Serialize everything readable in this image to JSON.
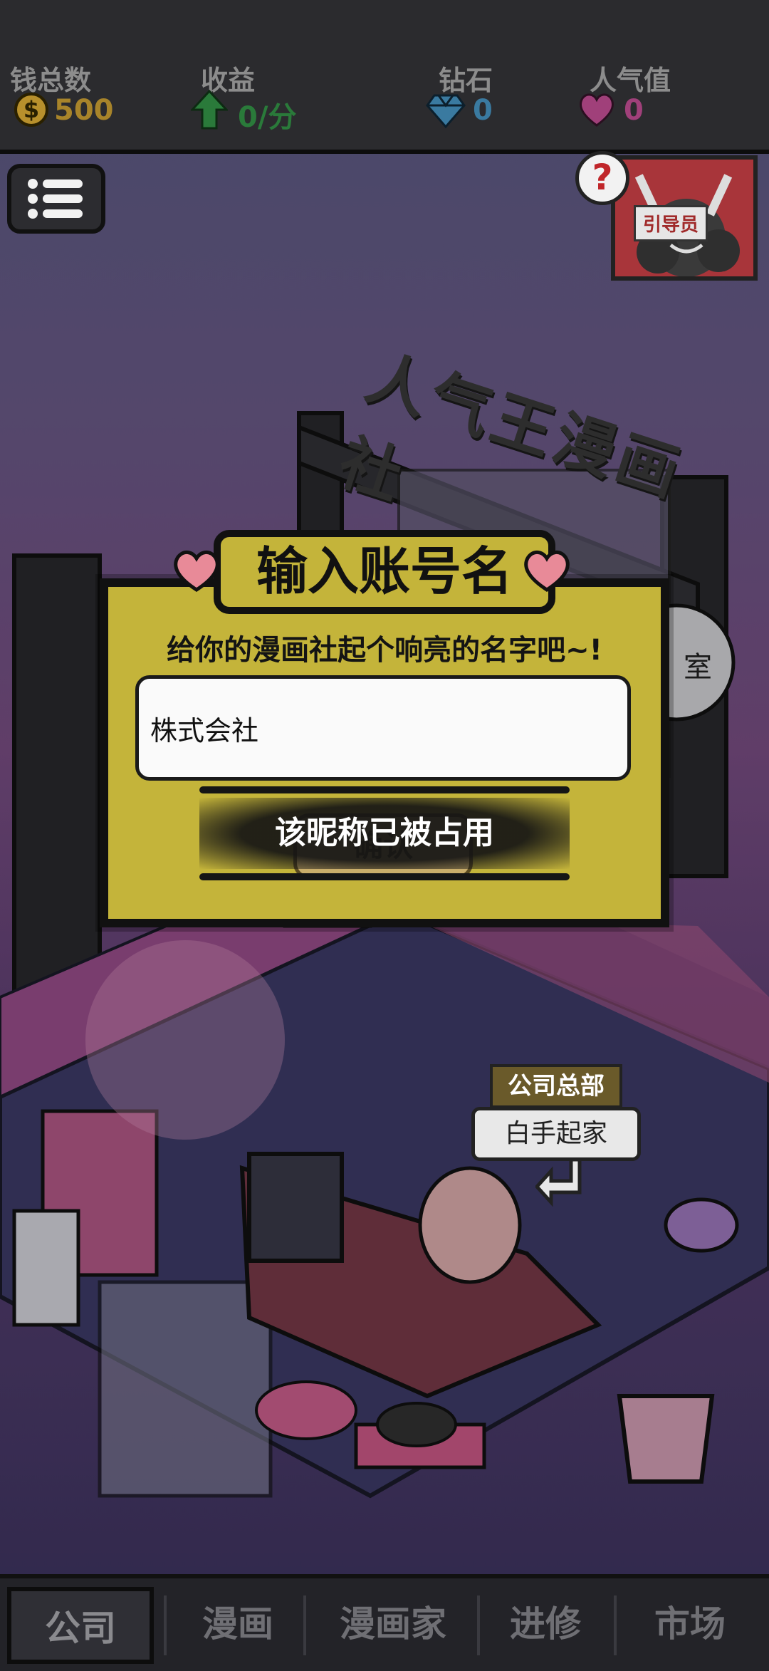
{
  "stats": {
    "money": {
      "label": "钱总数",
      "value": "500",
      "icon": "coin-icon",
      "color": "#a8842a"
    },
    "income": {
      "label": "收益",
      "value": "0/分",
      "icon": "up-arrow-icon",
      "color": "#2a7a3a"
    },
    "diamond": {
      "label": "钻石",
      "value": "0",
      "icon": "diamond-icon",
      "color": "#3a7aa0"
    },
    "popularity": {
      "label": "人气值",
      "value": "0",
      "icon": "heart-icon",
      "color": "#a0407a"
    }
  },
  "guide": {
    "label": "引导员",
    "question_mark": "?"
  },
  "scene": {
    "building_sign": "人气王漫画社",
    "partial_room_label": "室"
  },
  "dialog": {
    "title": "输入账号名",
    "subtitle": "给你的漫画社起个响亮的名字吧~!",
    "input_value": "株式会社",
    "confirm_label": "确认",
    "toast": "该昵称已被占用"
  },
  "hq": {
    "label": "公司总部",
    "status": "白手起家"
  },
  "nav": {
    "tabs": [
      {
        "label": "公司",
        "active": true
      },
      {
        "label": "漫画",
        "active": false
      },
      {
        "label": "漫画家",
        "active": false
      },
      {
        "label": "进修",
        "active": false
      },
      {
        "label": "市场",
        "active": false
      }
    ]
  }
}
